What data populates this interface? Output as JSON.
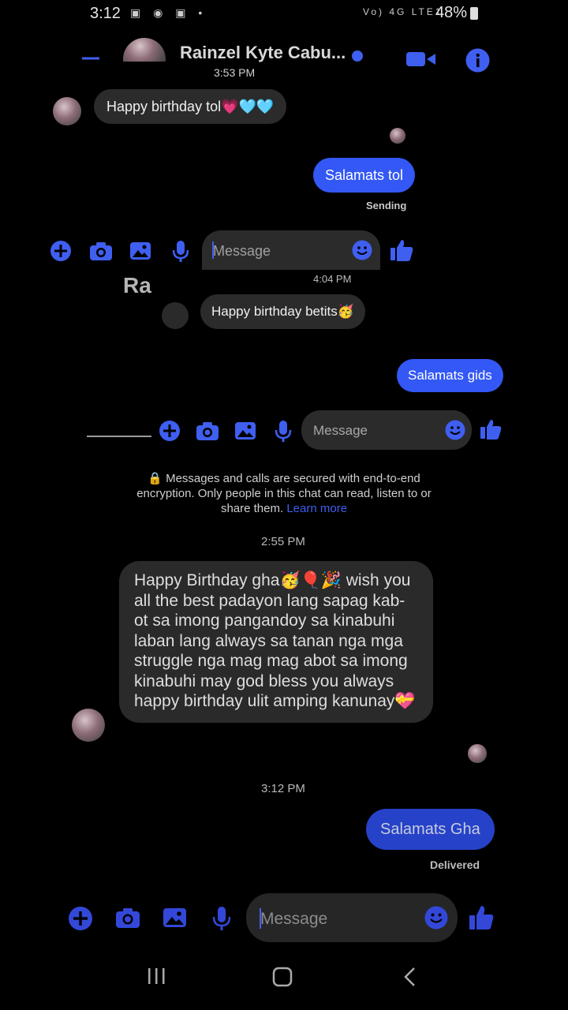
{
  "status": {
    "time": "3:12",
    "battery": "48%",
    "network": "Vo) 4G LTE1"
  },
  "header": {
    "title": "Rainzel Kyte Cabu...",
    "subtitle": "3:53 PM"
  },
  "thread1": {
    "incoming": "Happy birthday tol💗🩵🩵",
    "outgoing": "Salamats tol",
    "status": "Sending"
  },
  "composer1": {
    "placeholder": "Message"
  },
  "thread2": {
    "header_initials": "Ra",
    "time": "4:04 PM",
    "incoming": "Happy birthday betits🥳",
    "outgoing": "Salamats gids"
  },
  "composer2": {
    "placeholder": "Message"
  },
  "encryption": {
    "text": "🔒 Messages and calls are secured with end-to-end encryption. Only people in this chat can read, listen to or share them.",
    "link": "Learn more"
  },
  "thread3": {
    "time1": "2:55 PM",
    "incoming": "Happy Birthday gha🥳🎈🎉 wish you all the best padayon lang sapag kab-ot sa imong pangandoy sa kinabuhi laban lang always sa tanan nga mga struggle nga mag mag abot sa imong kinabuhi may god bless you always happy birthday ulit amping kanunay💝",
    "time2": "3:12 PM",
    "outgoing": "Salamats Gha",
    "status": "Delivered"
  },
  "composer3": {
    "placeholder": "Message"
  },
  "colors": {
    "accent": "#3f5ff0",
    "bubble_out": "#3358f5",
    "bubble_in": "#2b2b2b"
  }
}
